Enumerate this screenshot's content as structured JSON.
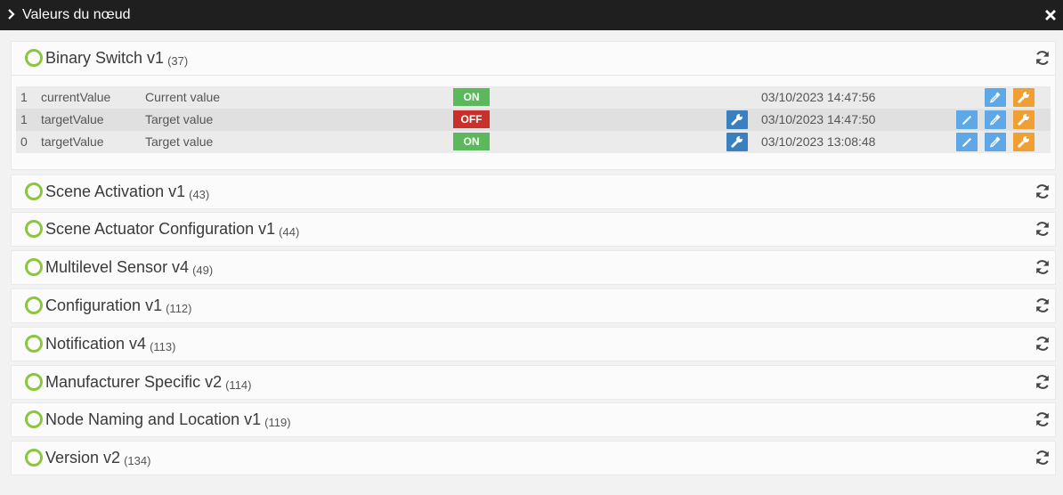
{
  "window": {
    "title": "Valeurs du nœud"
  },
  "icons": {
    "status": "status-ring-icon",
    "refresh": "refresh-icon",
    "set": "wrench-icon",
    "edit": "pencil-icon",
    "debug": "dropper-icon",
    "config": "wrench-icon"
  },
  "colors": {
    "on": "#5cb85c",
    "off": "#c9302c",
    "status_ring": "#8cc63f",
    "title_bar": "#1f1f1f"
  },
  "command_classes": [
    {
      "name": "Binary Switch v1",
      "id": "(37)",
      "expanded": true,
      "values": [
        {
          "instance": "1",
          "name": "currentValue",
          "label": "Current value",
          "state": "ON",
          "date": "03/10/2023 14:47:56"
        },
        {
          "instance": "1",
          "name": "targetValue",
          "label": "Target value",
          "state": "OFF",
          "date": "03/10/2023 14:47:50"
        },
        {
          "instance": "0",
          "name": "targetValue",
          "label": "Target value",
          "state": "ON",
          "date": "03/10/2023 13:08:48"
        }
      ]
    },
    {
      "name": "Scene Activation v1",
      "id": "(43)"
    },
    {
      "name": "Scene Actuator Configuration v1",
      "id": "(44)"
    },
    {
      "name": "Multilevel Sensor v4",
      "id": "(49)"
    },
    {
      "name": "Configuration v1",
      "id": "(112)"
    },
    {
      "name": "Notification v4",
      "id": "(113)"
    },
    {
      "name": "Manufacturer Specific v2",
      "id": "(114)"
    },
    {
      "name": "Node Naming and Location v1",
      "id": "(119)"
    },
    {
      "name": "Version v2",
      "id": "(134)"
    }
  ]
}
